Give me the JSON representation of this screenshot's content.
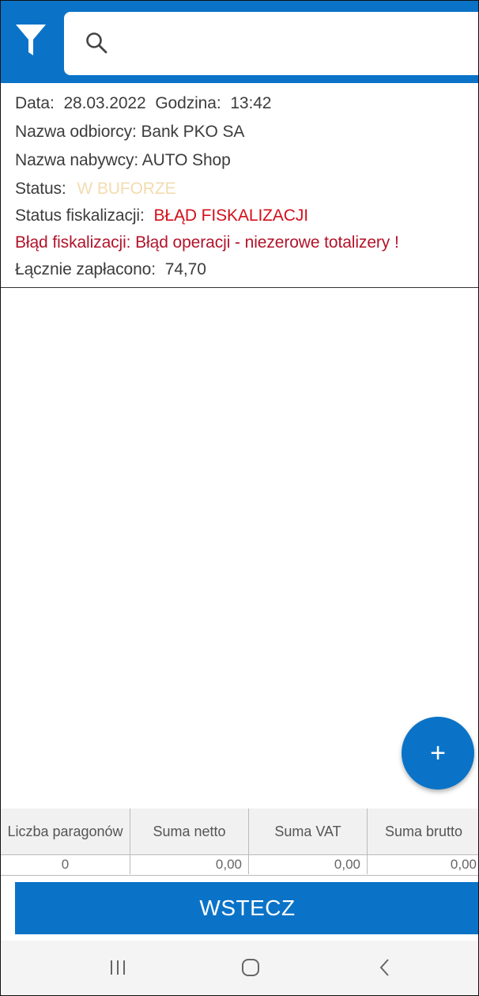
{
  "search": {
    "placeholder": "",
    "value": ""
  },
  "info": {
    "date_label": "Data:",
    "date_value": "28.03.2022",
    "time_label": "Godzina:",
    "time_value": "13:42",
    "recipient_label": "Nazwa odbiorcy:",
    "recipient_value": "Bank PKO SA",
    "buyer_label": "Nazwa nabywcy:",
    "buyer_value": "AUTO Shop",
    "status_label": "Status:",
    "status_value": "W BUFORZE",
    "fiscal_status_label": "Status fiskalizacji:",
    "fiscal_status_value": "BŁĄD FISKALIZACJI",
    "fiscal_error": "Błąd fiskalizacji: Błąd operacji - niezerowe totalizery !",
    "total_paid_label": "Łącznie zapłacono:",
    "total_paid_value": "74,70"
  },
  "summary": {
    "headers": [
      "Liczba paragonów",
      "Suma netto",
      "Suma VAT",
      "Suma brutto"
    ],
    "values": [
      "0",
      "0,00",
      "0,00",
      "0,00"
    ]
  },
  "buttons": {
    "add": "+",
    "back": "WSTECZ"
  },
  "colors": {
    "accent": "#0a73c8",
    "error": "#d40f1a",
    "error_text": "#b2142b",
    "buffer_status": "#f2dcb0"
  },
  "icons": [
    "filter-icon",
    "search-icon",
    "plus-icon",
    "recent-apps-icon",
    "home-icon",
    "back-icon"
  ]
}
